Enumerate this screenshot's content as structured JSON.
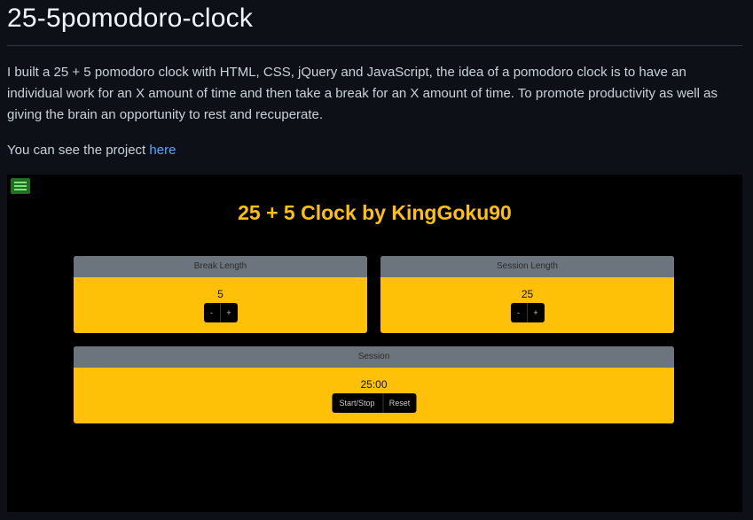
{
  "article": {
    "title": "25-5pomodoro-clock",
    "description": "I built a 25 + 5 pomodoro clock with HTML, CSS, jQuery and JavaScript, the idea of a pomodoro clock is to have an individual work for an X amount of time and then take a break for an X amount of time. To promote productivity as well as giving the brain an opportunity to rest and recuperate.",
    "see_prefix": "You can see the project ",
    "see_link": "here"
  },
  "embed": {
    "menu_icon": "hamburger-menu-icon",
    "clock_title": "25 + 5 Clock by KingGoku90",
    "break": {
      "label": "Break Length",
      "value": "5",
      "decrement": "-",
      "increment": "+"
    },
    "session_length": {
      "label": "Session Length",
      "value": "25",
      "decrement": "-",
      "increment": "+"
    },
    "timer": {
      "label": "Session",
      "value": "25:00",
      "start_stop": "Start/Stop",
      "reset": "Reset"
    },
    "colors": {
      "accent": "#ffc107",
      "header": "#6c757d",
      "link": "#58a6ff",
      "page_bg": "#0d1117"
    }
  }
}
